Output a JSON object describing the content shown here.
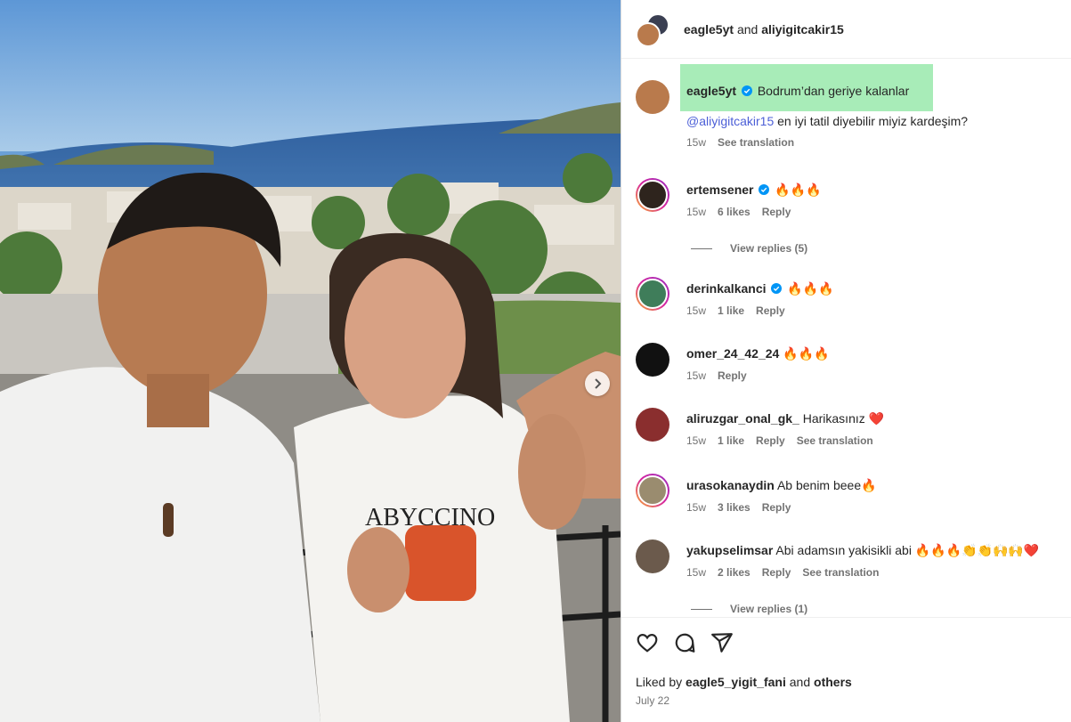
{
  "header": {
    "user1": "eagle5yt",
    "connector": "and",
    "user2": "aliyigitcakir15"
  },
  "caption": {
    "username": "eagle5yt",
    "text": "Bodrum’dan geriye kalanlar",
    "mention": "@aliyigitcakir15",
    "text2": "en iyi tatil diyebilir miyiz kardeşim?",
    "time": "15w",
    "see_translation": "See translation"
  },
  "comments": [
    {
      "username": "ertemsener",
      "verified": true,
      "text": "🔥🔥🔥",
      "time": "15w",
      "likes": "6 likes",
      "reply": "Reply",
      "see_translation": "",
      "view_replies": "View replies (5)"
    },
    {
      "username": "derinkalkanci",
      "verified": true,
      "text": "🔥🔥🔥",
      "time": "15w",
      "likes": "1 like",
      "reply": "Reply",
      "see_translation": "",
      "view_replies": ""
    },
    {
      "username": "omer_24_42_24",
      "verified": false,
      "text": "🔥🔥🔥",
      "time": "15w",
      "likes": "",
      "reply": "Reply",
      "see_translation": "",
      "view_replies": ""
    },
    {
      "username": "aliruzgar_onal_gk_",
      "verified": false,
      "text": "Harikasınız ❤️",
      "time": "15w",
      "likes": "1 like",
      "reply": "Reply",
      "see_translation": "See translation",
      "view_replies": ""
    },
    {
      "username": "urasokanaydin",
      "verified": false,
      "text": "Ab benim beee🔥",
      "time": "15w",
      "likes": "3 likes",
      "reply": "Reply",
      "see_translation": "",
      "view_replies": ""
    },
    {
      "username": "yakupselimsar",
      "verified": false,
      "text": "Abi adamsın yakisikli abi 🔥🔥🔥👏👏🙌🙌❤️",
      "time": "15w",
      "likes": "2 likes",
      "reply": "Reply",
      "see_translation": "See translation",
      "view_replies": "View replies (1)"
    }
  ],
  "footer": {
    "liked_by_prefix": "Liked by",
    "liked_by_user": "eagle5_yigit_fani",
    "liked_and": "and",
    "liked_others": "others",
    "date": "July 22"
  },
  "icons": [
    "chevron-right-icon",
    "heart-icon",
    "comment-icon",
    "share-icon",
    "verified-icon"
  ],
  "colors": {
    "verified": "#0095f6",
    "highlight": "#a8ecb8",
    "mention": "#4c5fd7",
    "meta": "#737373"
  }
}
